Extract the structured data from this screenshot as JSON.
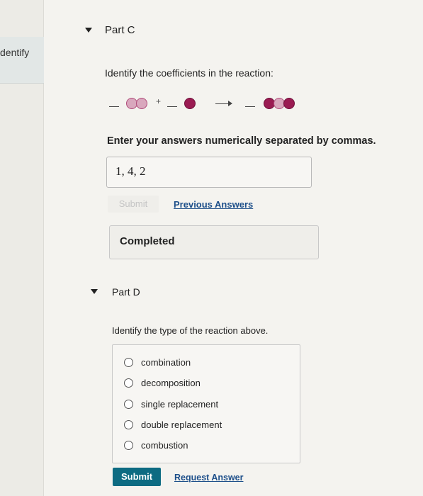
{
  "sidebar": {
    "tab_label": "dentify"
  },
  "part_c": {
    "title": "Part C",
    "prompt": "Identify the coefficients in the reaction:",
    "instruction": "Enter your answers numerically separated by commas.",
    "answer_value": "1, 4, 2",
    "submit_label": "Submit",
    "previous_answers_label": "Previous Answers",
    "status": "Completed",
    "reaction": {
      "plus": "+",
      "blank": "_"
    }
  },
  "part_d": {
    "title": "Part D",
    "prompt": "Identify the type of the reaction above.",
    "options": [
      "combination",
      "decomposition",
      "single replacement",
      "double replacement",
      "combustion"
    ],
    "submit_label": "Submit",
    "request_answer_label": "Request Answer"
  },
  "colors": {
    "accent": "#0d6b82",
    "link": "#1d4f8a",
    "atom_light": "#d9a7bd",
    "atom_dark": "#9a1b52"
  }
}
